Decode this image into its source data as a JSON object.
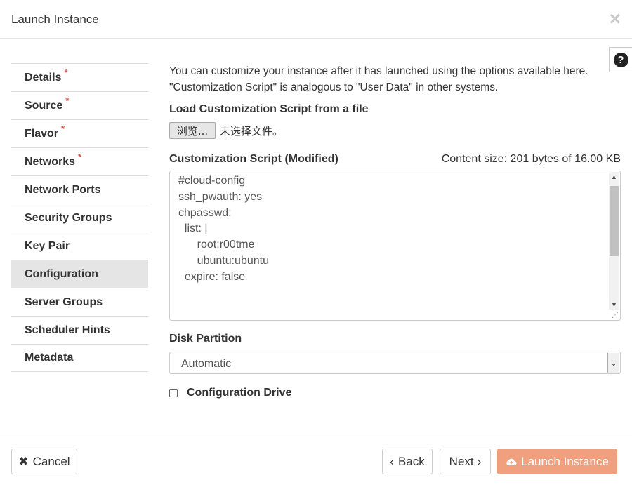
{
  "header": {
    "title": "Launch Instance",
    "close_glyph": "×"
  },
  "help": {
    "glyph": "?"
  },
  "sidebar": {
    "items": [
      {
        "label": "Details",
        "required": "*"
      },
      {
        "label": "Source",
        "required": "*"
      },
      {
        "label": "Flavor",
        "required": "*"
      },
      {
        "label": "Networks",
        "required": "*"
      },
      {
        "label": "Network Ports"
      },
      {
        "label": "Security Groups"
      },
      {
        "label": "Key Pair"
      },
      {
        "label": "Configuration",
        "active": true
      },
      {
        "label": "Server Groups"
      },
      {
        "label": "Scheduler Hints"
      },
      {
        "label": "Metadata"
      }
    ]
  },
  "main": {
    "intro_line1": "You can customize your instance after it has launched using the options available here.",
    "intro_line2": "\"Customization Script\" is analogous to \"User Data\" in other systems.",
    "load_label": "Load Customization Script from a file",
    "file_button": "浏览...",
    "file_status": "未选择文件。",
    "script_label": "Customization Script (Modified)",
    "content_size": "Content size: 201 bytes of 16.00 KB",
    "script_text": "#cloud-config\nssh_pwauth: yes\nchpasswd:\n  list: |\n      root:r00tme\n      ubuntu:ubuntu\n  expire: false",
    "disk_label": "Disk Partition",
    "disk_value": "Automatic",
    "config_drive_label": "Configuration Drive"
  },
  "footer": {
    "cancel": "Cancel",
    "back": "Back",
    "next": "Next",
    "launch": "Launch Instance"
  },
  "colors": {
    "accent": "#f0a07f",
    "required": "#d9534f",
    "active_nav": "#e5e5e5"
  }
}
